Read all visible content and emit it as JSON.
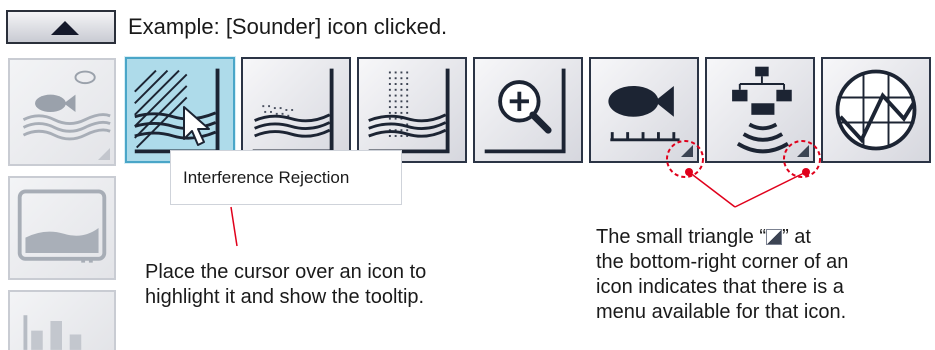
{
  "header": {
    "collapse_icon": "triangle-up-icon",
    "example_text": "Example: [Sounder] icon clicked."
  },
  "left_column": [
    {
      "name": "fish-waves-icon",
      "has_menu": true,
      "faded": true
    },
    {
      "name": "display-icon",
      "has_menu": false,
      "faded": true
    },
    {
      "name": "bar-graph-icon",
      "has_menu": false,
      "faded": true
    }
  ],
  "icon_row": [
    {
      "name": "interference-rejection-icon",
      "selected": true,
      "has_menu": false
    },
    {
      "name": "seabed-dots-icon",
      "selected": false,
      "has_menu": false
    },
    {
      "name": "dotted-layer-icon",
      "selected": false,
      "has_menu": false
    },
    {
      "name": "zoom-icon",
      "selected": false,
      "has_menu": false
    },
    {
      "name": "fish-scale-icon",
      "selected": false,
      "has_menu": true
    },
    {
      "name": "network-sonar-icon",
      "selected": false,
      "has_menu": true
    },
    {
      "name": "graph-circle-icon",
      "selected": false,
      "has_menu": false
    }
  ],
  "tooltip": {
    "text": "Interference Rejection"
  },
  "annotations": {
    "cursor_note_line1": "Place the cursor over an icon to",
    "cursor_note_line2": "highlight it and show the tooltip.",
    "triangle_note_line1_pre": "The small triangle “",
    "triangle_note_line1_post": "”  at",
    "triangle_note_line2": "the bottom-right corner of an",
    "triangle_note_line3": "icon indicates that there is a",
    "triangle_note_line4": "menu available for that icon.",
    "callout_color": "#e0001b"
  }
}
